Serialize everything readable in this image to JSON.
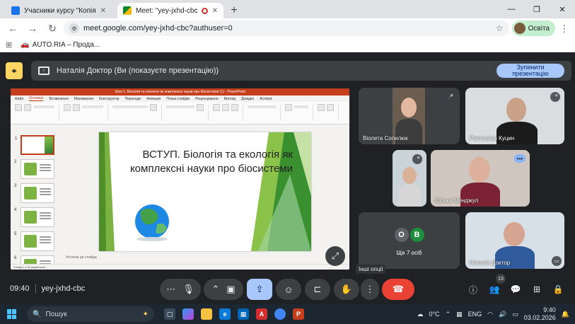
{
  "browser": {
    "tabs": [
      {
        "title": "Учасники курсу \"Копія курсу",
        "active": false
      },
      {
        "title": "Meet: \"yey-jxhd-cbc\"",
        "active": true
      }
    ],
    "url": "meet.google.com/yey-jxhd-cbc?authuser=0",
    "profile_label": "Освіта",
    "bookmark": "AUTO.RIA – Прода..."
  },
  "presenting": {
    "banner_text": "Наталія Доктор (Ви (показуєте презентацію))",
    "stop_label": "Зупинити презентацію"
  },
  "presentation": {
    "window_title": "Урок 1. Біологія та екологія як комплексні науки про біосистеми (1) - PowerPoint",
    "menu": [
      "Файл",
      "Основне",
      "Вставлення",
      "Малювання",
      "Конструктор",
      "Переходи",
      "Анімація",
      "Показ слайдів",
      "Рецензування",
      "Вигляд",
      "Довідка",
      "Acrobat"
    ],
    "slide_title": "ВСТУП. Біологія та екологія як комплексні науки про біосистеми",
    "notes": "Нотатки до слайда",
    "status": "Слайд 1 з 15   українська",
    "slide_numbers": [
      "1",
      "2",
      "3",
      "4",
      "5",
      "6"
    ]
  },
  "participants": [
    {
      "name": "Віолета Сопилюк"
    },
    {
      "name": "Ростислав Куцин"
    },
    {
      "name": ""
    },
    {
      "name": "Юлька Менджул"
    },
    {
      "name": "Наталія Доктор"
    }
  ],
  "others": {
    "label": "Ще 7 осіб",
    "initials": [
      "O",
      "B"
    ],
    "colors": [
      "#5f6368",
      "#1e8e3e"
    ]
  },
  "tooltip": "Інші опції",
  "meeting": {
    "time": "09:40",
    "code": "yey-jxhd-cbc",
    "people_count": "13"
  },
  "icons": {
    "expand": "expand-icon",
    "mic": "mic-icon",
    "camera": "camera-icon",
    "present": "present-icon",
    "emoji": "emoji-icon",
    "captions": "captions-icon",
    "hand": "raise-hand-icon",
    "more": "more-vert-icon",
    "end": "end-call-icon"
  },
  "taskbar": {
    "search_placeholder": "Пошук",
    "weather": "0°C",
    "lang": "ENG",
    "time": "9:40",
    "date": "03.02.2026"
  }
}
